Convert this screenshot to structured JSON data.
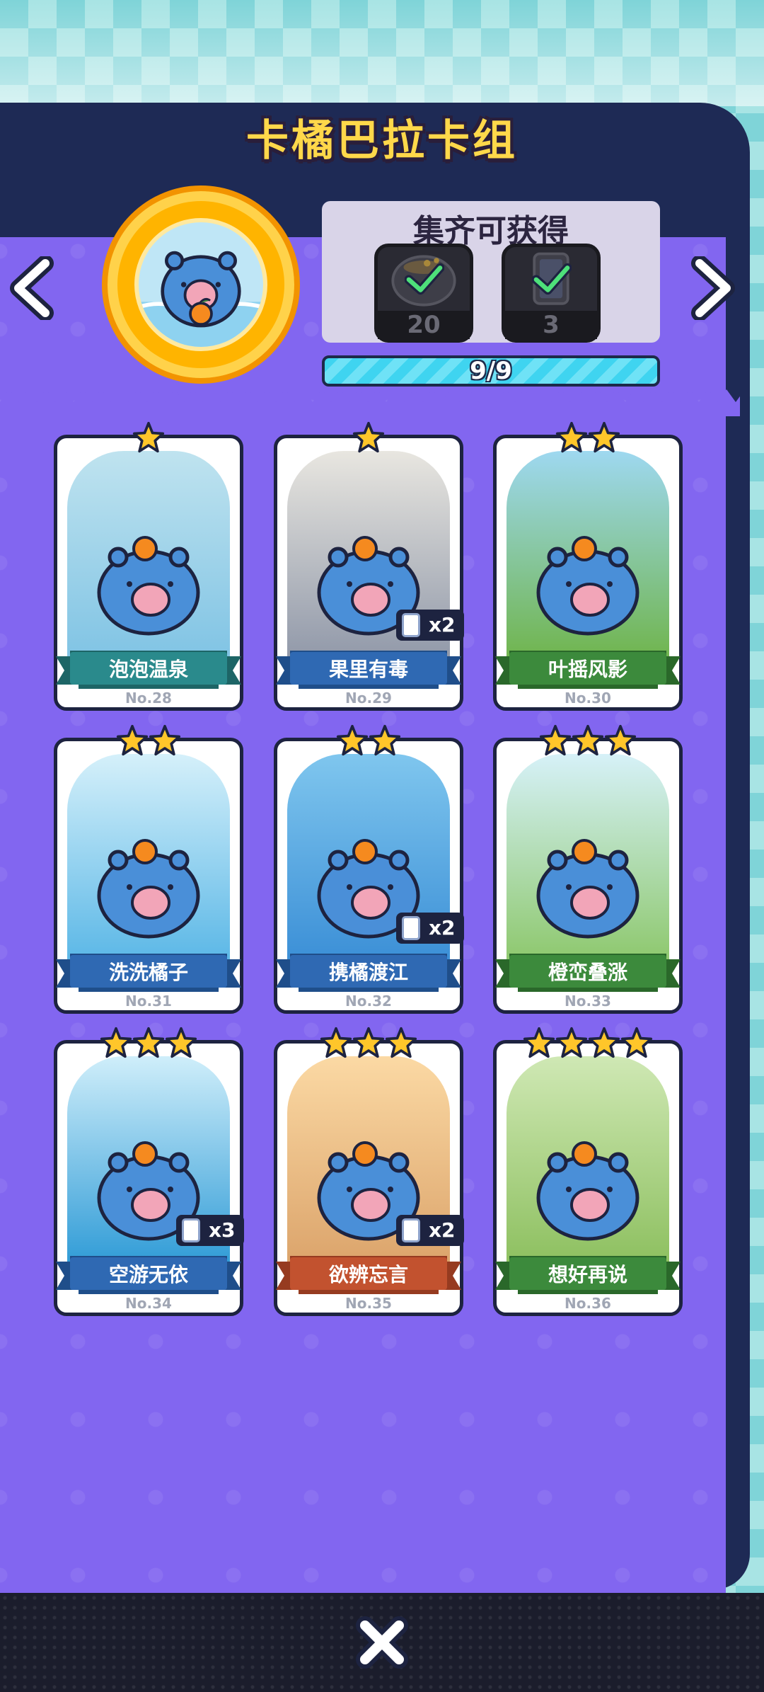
{
  "header": {
    "title": "卡橘巴拉卡组"
  },
  "rewards": {
    "title": "集齐可获得",
    "items": [
      {
        "icon": "coin-pouch-icon",
        "count": "20",
        "claimed": true
      },
      {
        "icon": "card-pack-icon",
        "count": "3",
        "claimed": true
      }
    ],
    "progress": {
      "text": "9/9",
      "fraction": 1.0
    }
  },
  "cards": [
    {
      "name": "泡泡温泉",
      "no": "No.28",
      "stars": 1,
      "dup": "",
      "ribbon": "#2a8a8c",
      "ribbon_dark": "#1d6566",
      "art_top": "#bfe3ef",
      "art_bottom": "#7fc3e4"
    },
    {
      "name": "果里有毒",
      "no": "No.29",
      "stars": 1,
      "dup": "x2",
      "ribbon": "#2f69b3",
      "ribbon_dark": "#1f4e8a",
      "art_top": "#e8e6e0",
      "art_bottom": "#8f97a8"
    },
    {
      "name": "叶摇风影",
      "no": "No.30",
      "stars": 2,
      "dup": "",
      "ribbon": "#3c8a3c",
      "ribbon_dark": "#2a682a",
      "art_top": "#9ed8f0",
      "art_bottom": "#6fb44a"
    },
    {
      "name": "洗洗橘子",
      "no": "No.31",
      "stars": 2,
      "dup": "",
      "ribbon": "#2f69b3",
      "ribbon_dark": "#1f4e8a",
      "art_top": "#d5f0fa",
      "art_bottom": "#58b6e6"
    },
    {
      "name": "携橘渡江",
      "no": "No.32",
      "stars": 2,
      "dup": "x2",
      "ribbon": "#2f69b3",
      "ribbon_dark": "#1f4e8a",
      "art_top": "#7fc6ee",
      "art_bottom": "#3a8ed6"
    },
    {
      "name": "橙峦叠涨",
      "no": "No.33",
      "stars": 3,
      "dup": "",
      "ribbon": "#3c8a3c",
      "ribbon_dark": "#2a682a",
      "art_top": "#d6f1f8",
      "art_bottom": "#8cc76a"
    },
    {
      "name": "空游无依",
      "no": "No.34",
      "stars": 3,
      "dup": "x3",
      "ribbon": "#2f69b3",
      "ribbon_dark": "#1f4e8a",
      "art_top": "#cfeefa",
      "art_bottom": "#2d9ad6"
    },
    {
      "name": "欲辨忘言",
      "no": "No.35",
      "stars": 3,
      "dup": "x2",
      "ribbon": "#c2522f",
      "ribbon_dark": "#963b20",
      "art_top": "#fbd9a4",
      "art_bottom": "#dba36a"
    },
    {
      "name": "想好再说",
      "no": "No.36",
      "stars": 4,
      "dup": "",
      "ribbon": "#3c8a3c",
      "ribbon_dark": "#2a682a",
      "art_top": "#cfe8b4",
      "art_bottom": "#8cbf5e"
    }
  ],
  "controls": {
    "prev_icon": "chevron-left-icon",
    "next_icon": "chevron-right-icon",
    "close_icon": "close-icon"
  }
}
